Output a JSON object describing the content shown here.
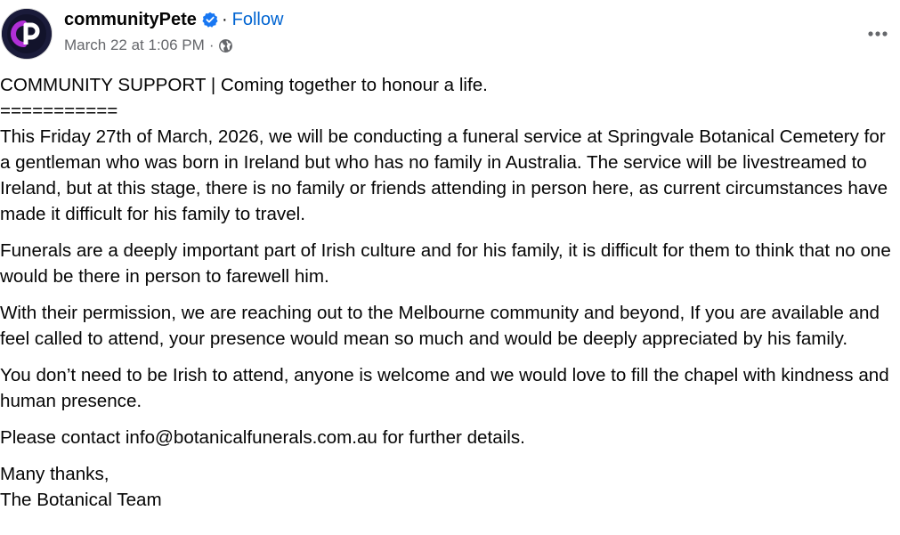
{
  "post": {
    "author": "communityPete",
    "follow_label": "Follow",
    "separator": "·",
    "timestamp": "March 22 at 1:06 PM",
    "audience_icon": "globe-icon",
    "more_icon": "more-horizontal-icon",
    "avatar_icon": "communitypete-logo",
    "verified_icon": "verified-badge-icon",
    "colors": {
      "text": "#050505",
      "meta": "#65676b",
      "follow": "#0064d1",
      "verified": "#1877f2",
      "avatar_bg": "#1a1b3a",
      "avatar_c": "#b02fd6",
      "avatar_p": "#ffffff"
    }
  },
  "body": {
    "heading": "COMMUNITY SUPPORT | Coming together to honour a life.",
    "divider": "===========",
    "paragraph1": "This Friday 27th of March, 2026, we will be conducting a funeral service at Springvale Botanical Cemetery for a gentleman who was born in Ireland but who has no family in Australia. The service will be livestreamed to Ireland, but at this stage, there is no family or friends attending in person here, as current circumstances have made it difficult for his family to travel.",
    "paragraph2": "Funerals are a deeply important part of Irish culture and for his family, it is difficult for them to think that no one would be there in person to farewell him.",
    "paragraph3": "With their permission, we are reaching out to the Melbourne community and beyond, If you are available and feel called to attend, your presence would mean so much and would be deeply appreciated by his family.",
    "paragraph4": "You don’t need to be Irish to attend, anyone is welcome and we would love to fill the chapel with kindness and human presence.",
    "contact_prefix": "Please contact ",
    "contact_email": "info@botanicalfunerals.com.au",
    "contact_suffix": " for further details.",
    "signoff": "Many thanks,",
    "signature": "The Botanical Team"
  }
}
